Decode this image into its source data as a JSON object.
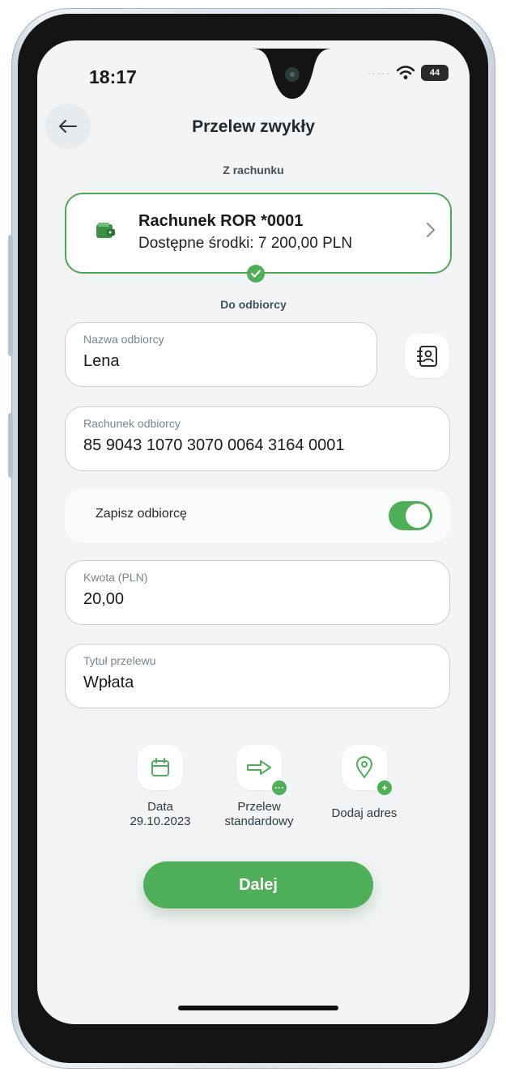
{
  "status": {
    "time": "18:17",
    "battery": "44"
  },
  "header": {
    "title": "Przelew zwykły"
  },
  "from_section": {
    "label": "Z rachunku",
    "account_name": "Rachunek ROR *0001",
    "available": "Dostępne środki: 7 200,00 PLN"
  },
  "to_section": {
    "label": "Do odbiorcy"
  },
  "fields": {
    "recipient_name": {
      "label": "Nazwa odbiorcy",
      "value": "Lena"
    },
    "recipient_account": {
      "label": "Rachunek odbiorcy",
      "value": "85 9043 1070 3070 0064 3164 0001"
    },
    "amount": {
      "label": "Kwota (PLN)",
      "value": "20,00"
    },
    "title": {
      "label": "Tytuł przelewu",
      "value": "Wpłata"
    }
  },
  "save_recipient": {
    "label": "Zapisz odbiorcę",
    "enabled": true
  },
  "options": {
    "date_label": "Data",
    "date_value": "29.10.2023",
    "type_label": "Przelew",
    "type_value": "standardowy",
    "address_label": "Dodaj adres"
  },
  "cta": {
    "label": "Dalej"
  },
  "colors": {
    "accent": "#4fae58",
    "background": "#f2f4f5"
  },
  "icons": [
    "back-arrow-icon",
    "wifi-icon",
    "battery-icon",
    "wallet-icon",
    "chevron-right-icon",
    "check-icon",
    "contact-card-icon",
    "calendar-icon",
    "arrow-transfer-icon",
    "location-pin-icon",
    "plus-icon"
  ]
}
